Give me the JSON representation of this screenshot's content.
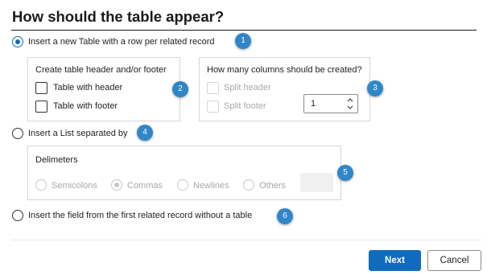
{
  "title": "How should the table appear?",
  "option_table": {
    "label": "Insert a new Table with a row per related record",
    "badge": "1",
    "selected": true
  },
  "header_footer_group": {
    "title": "Create table header and/or footer",
    "badge": "2",
    "items": [
      {
        "label": "Table with header",
        "checked": false
      },
      {
        "label": "Table with footer",
        "checked": false
      }
    ]
  },
  "columns_group": {
    "title": "How many columns should be created?",
    "badge": "3",
    "items": [
      {
        "label": "Split header",
        "checked": false,
        "disabled": true
      },
      {
        "label": "Split footer",
        "checked": false,
        "disabled": true
      }
    ],
    "stepper_value": "1"
  },
  "option_list": {
    "label": "Insert a List separated by",
    "badge": "4",
    "selected": false
  },
  "delimiters_group": {
    "title": "Delimeters",
    "badge": "5",
    "options": [
      {
        "label": "Semicolons",
        "selected": false
      },
      {
        "label": "Commas",
        "selected": true
      },
      {
        "label": "Newlines",
        "selected": false
      },
      {
        "label": "Others",
        "selected": false
      }
    ]
  },
  "option_field": {
    "label": "Insert the field from the first related record without a table",
    "badge": "6",
    "selected": false
  },
  "buttons": {
    "next": "Next",
    "cancel": "Cancel"
  },
  "colors": {
    "accent": "#0f6cbd",
    "badge": "#2f86c9"
  }
}
